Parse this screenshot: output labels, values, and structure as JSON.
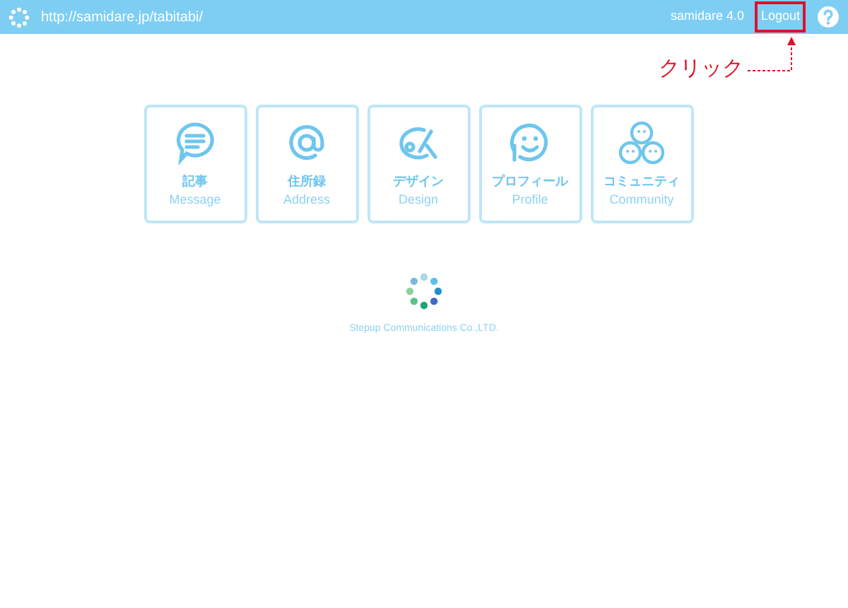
{
  "header": {
    "url": "http://samidare.jp/tabitabi/",
    "version": "samidare 4.0",
    "logout": {
      "label": "Logout",
      "highlighted": true
    }
  },
  "annotation": {
    "text": "クリック"
  },
  "tiles": [
    {
      "kind": "message",
      "title": "記事",
      "subtitle": "Message"
    },
    {
      "kind": "address",
      "title": "住所録",
      "subtitle": "Address"
    },
    {
      "kind": "design",
      "title": "デザイン",
      "subtitle": "Design"
    },
    {
      "kind": "profile",
      "title": "プロフィール",
      "subtitle": "Profile"
    },
    {
      "kind": "community",
      "title": "コミュニティ",
      "subtitle": "Community"
    }
  ],
  "footer": "Stepup Communications Co.,LTD."
}
